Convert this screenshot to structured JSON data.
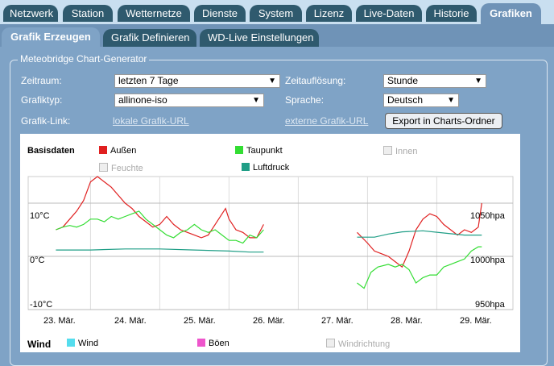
{
  "top_tabs": [
    "Netzwerk",
    "Station",
    "Wetternetze",
    "Dienste",
    "System",
    "Lizenz",
    "Live-Daten",
    "Historie",
    "Grafiken"
  ],
  "sub_tabs": [
    "Grafik Erzeugen",
    "Grafik Definieren",
    "WD-Live Einstellungen"
  ],
  "form": {
    "legend": "Meteobridge Chart-Generator",
    "zeitraum_label": "Zeitraum:",
    "zeitraum_value": "letzten 7 Tage",
    "zeitaufloesung_label": "Zeitauflösung:",
    "zeitaufloesung_value": "Stunde",
    "grafiktyp_label": "Grafiktyp:",
    "grafiktyp_value": "allinone-iso",
    "sprache_label": "Sprache:",
    "sprache_value": "Deutsch",
    "grafiklink_label": "Grafik-Link:",
    "lokal_link": "lokale Grafik-URL",
    "extern_link": "externe Grafik-URL",
    "export_button": "Export in Charts-Ordner"
  },
  "chart_legend": {
    "group1": "Basisdaten",
    "aussen": "Außen",
    "taupunkt": "Taupunkt",
    "innen": "Innen",
    "feuchte": "Feuchte",
    "luftdruck": "Luftdruck",
    "group2": "Wind",
    "wind": "Wind",
    "boeen": "Böen",
    "windrichtung": "Windrichtung"
  },
  "colors": {
    "aussen": "#e02020",
    "taupunkt": "#33dd33",
    "luftdruck": "#1f9e86",
    "wind": "#55ddee",
    "boeen": "#ee55cc"
  },
  "chart_data": {
    "type": "line",
    "x": [
      "23. Mär.",
      "24. Mär.",
      "25. Mär.",
      "26. Mär.",
      "27. Mär.",
      "28. Mär.",
      "29. Mär."
    ],
    "y_left_ticks": [
      "10°C",
      "0°C",
      "-10°C"
    ],
    "y_right_ticks": [
      "1050hpa",
      "1000hpa",
      "950hpa"
    ],
    "ylim_left": [
      -10,
      15
    ],
    "ylim_right": [
      950,
      1075
    ],
    "series": [
      {
        "name": "Außen",
        "color": "#e02020",
        "axis": "left",
        "segments": [
          [
            [
              0,
              5
            ],
            [
              0.1,
              5.5
            ],
            [
              0.2,
              7
            ],
            [
              0.3,
              8.5
            ],
            [
              0.4,
              10.5
            ],
            [
              0.5,
              14
            ],
            [
              0.6,
              15
            ],
            [
              0.7,
              14
            ],
            [
              0.8,
              13
            ],
            [
              0.9,
              11.5
            ],
            [
              1.0,
              10
            ],
            [
              1.1,
              9
            ],
            [
              1.2,
              7.5
            ],
            [
              1.3,
              6.5
            ],
            [
              1.4,
              5.5
            ],
            [
              1.5,
              6
            ],
            [
              1.6,
              7.5
            ],
            [
              1.7,
              6
            ],
            [
              1.8,
              5
            ],
            [
              1.9,
              4.5
            ],
            [
              2.0,
              4
            ],
            [
              2.1,
              3.5
            ],
            [
              2.2,
              4
            ],
            [
              2.3,
              6
            ],
            [
              2.4,
              8
            ],
            [
              2.45,
              9
            ],
            [
              2.5,
              7
            ],
            [
              2.6,
              5
            ],
            [
              2.7,
              4.5
            ],
            [
              2.8,
              3.5
            ],
            [
              2.9,
              3.5
            ],
            [
              3.0,
              6
            ]
          ],
          [
            [
              4.35,
              4.5
            ],
            [
              4.5,
              2.5
            ],
            [
              4.6,
              1
            ],
            [
              4.7,
              0.5
            ],
            [
              4.8,
              0
            ],
            [
              4.9,
              -1
            ],
            [
              5.0,
              -2
            ],
            [
              5.1,
              1
            ],
            [
              5.2,
              5
            ],
            [
              5.3,
              7
            ],
            [
              5.4,
              8
            ],
            [
              5.5,
              7.5
            ],
            [
              5.6,
              6
            ],
            [
              5.7,
              5
            ],
            [
              5.8,
              4
            ],
            [
              5.9,
              5
            ],
            [
              6.0,
              4.5
            ],
            [
              6.1,
              5.5
            ],
            [
              6.15,
              10
            ]
          ]
        ]
      },
      {
        "name": "Taupunkt",
        "color": "#33dd33",
        "axis": "left",
        "segments": [
          [
            [
              0,
              5
            ],
            [
              0.1,
              5.5
            ],
            [
              0.2,
              5.8
            ],
            [
              0.3,
              5.5
            ],
            [
              0.4,
              6
            ],
            [
              0.5,
              7
            ],
            [
              0.6,
              7
            ],
            [
              0.7,
              6.5
            ],
            [
              0.8,
              7.5
            ],
            [
              0.9,
              7
            ],
            [
              1.0,
              7.5
            ],
            [
              1.1,
              8
            ],
            [
              1.2,
              8.5
            ],
            [
              1.3,
              7
            ],
            [
              1.4,
              6
            ],
            [
              1.5,
              5
            ],
            [
              1.6,
              4
            ],
            [
              1.7,
              3.5
            ],
            [
              1.8,
              4.5
            ],
            [
              1.9,
              5
            ],
            [
              2.0,
              6
            ],
            [
              2.1,
              5
            ],
            [
              2.2,
              4.5
            ],
            [
              2.3,
              5
            ],
            [
              2.4,
              4
            ],
            [
              2.5,
              3
            ],
            [
              2.6,
              3
            ],
            [
              2.7,
              2.5
            ],
            [
              2.8,
              4
            ],
            [
              2.9,
              3.5
            ],
            [
              3.0,
              5
            ]
          ],
          [
            [
              4.35,
              -5
            ],
            [
              4.45,
              -6
            ],
            [
              4.55,
              -3
            ],
            [
              4.65,
              -2
            ],
            [
              4.8,
              -1.5
            ],
            [
              4.9,
              -2
            ],
            [
              5.0,
              -1.5
            ],
            [
              5.1,
              -2.5
            ],
            [
              5.2,
              -5
            ],
            [
              5.3,
              -4
            ],
            [
              5.4,
              -3.5
            ],
            [
              5.5,
              -3.5
            ],
            [
              5.6,
              -2
            ],
            [
              5.7,
              -1.5
            ],
            [
              5.8,
              -1
            ],
            [
              5.9,
              -0.5
            ],
            [
              6.0,
              1
            ],
            [
              6.1,
              1.8
            ],
            [
              6.15,
              1.8
            ]
          ]
        ]
      },
      {
        "name": "Luftdruck",
        "color": "#1f9e86",
        "axis": "right",
        "segments": [
          [
            [
              0,
              1006
            ],
            [
              0.5,
              1006
            ],
            [
              1.0,
              1007
            ],
            [
              1.5,
              1007
            ],
            [
              2.0,
              1006
            ],
            [
              2.5,
              1005
            ],
            [
              2.8,
              1004
            ],
            [
              3.0,
              1004
            ]
          ],
          [
            [
              4.35,
              1018
            ],
            [
              4.6,
              1018
            ],
            [
              4.8,
              1021
            ],
            [
              5.0,
              1023
            ],
            [
              5.3,
              1024
            ],
            [
              5.6,
              1022
            ],
            [
              5.9,
              1020
            ],
            [
              6.15,
              1020
            ]
          ]
        ]
      }
    ]
  }
}
